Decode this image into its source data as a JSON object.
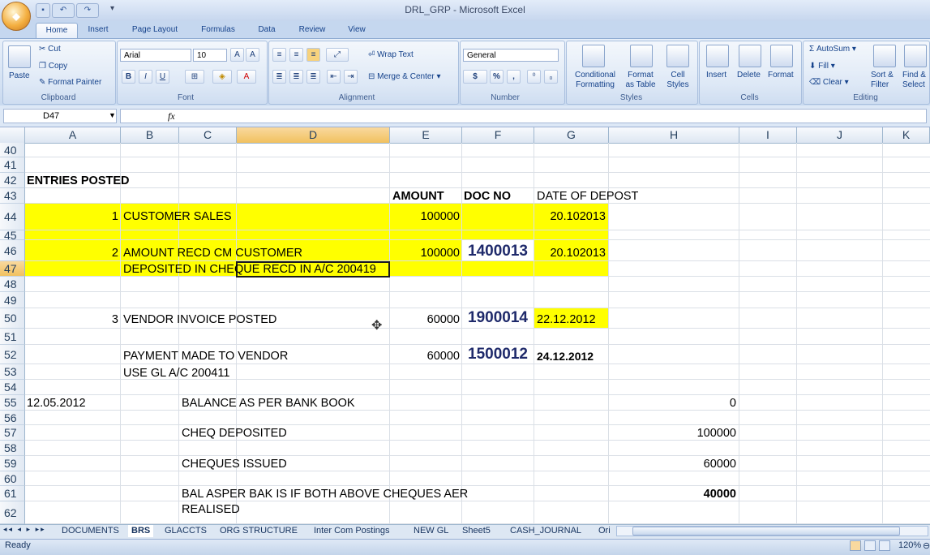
{
  "window": {
    "title": "DRL_GRP - Microsoft Excel"
  },
  "ribbon_tabs": [
    "Home",
    "Insert",
    "Page Layout",
    "Formulas",
    "Data",
    "Review",
    "View"
  ],
  "clipboard": {
    "paste": "Paste",
    "cut": "Cut",
    "copy": "Copy",
    "format_painter": "Format Painter",
    "label": "Clipboard"
  },
  "font": {
    "name": "Arial",
    "size": "10",
    "bold": "B",
    "italic": "I",
    "underline": "U",
    "label": "Font"
  },
  "alignment": {
    "wrap_text": "Wrap Text",
    "merge_center": "Merge & Center",
    "label": "Alignment"
  },
  "number": {
    "format": "General",
    "currency": "$",
    "percent": "%",
    "comma": ",",
    "label": "Number"
  },
  "styles": {
    "conditional": "Conditional",
    "formatting": "Formatting",
    "format_as": "Format",
    "as_table": "as Table",
    "cell": "Cell",
    "cell_styles": "Styles",
    "label": "Styles"
  },
  "cells": {
    "insert": "Insert",
    "delete": "Delete",
    "format": "Format",
    "label": "Cells"
  },
  "editing": {
    "autosum": "AutoSum",
    "fill": "Fill",
    "clear": "Clear",
    "sort": "Sort &",
    "filter": "Filter",
    "find": "Find &",
    "select": "Select",
    "label": "Editing"
  },
  "formula_bar": {
    "name_box": "D47",
    "fx": "fx",
    "content": ""
  },
  "columns": [
    "A",
    "B",
    "C",
    "D",
    "E",
    "F",
    "G",
    "H",
    "I",
    "J",
    "K"
  ],
  "rows": [
    "40",
    "41",
    "42",
    "43",
    "44",
    "45",
    "46",
    "47",
    "48",
    "49",
    "50",
    "51",
    "52",
    "53",
    "54",
    "55",
    "56",
    "57",
    "58",
    "59",
    "60",
    "61",
    "62"
  ],
  "cells_text": {
    "r42_a": "ENTRIES POSTED",
    "r43_e": "AMOUNT",
    "r43_f": "DOC NO",
    "r43_g": "DATE OF DEPOST",
    "r44_b": "1",
    "r44_c": "CUSTOMER SALES",
    "r44_e": "100000",
    "r44_g": "20.102013",
    "r46_b": "2",
    "r46_c": "AMOUNT RECD CM CUSTOMER",
    "r46_e": "100000",
    "r46_f": "1400013",
    "r46_g": "20.102013",
    "r47_c": "DEPOSITED IN  CHEQUE RECD IN A/C 200419",
    "r50_b": "3",
    "r50_c": "VENDOR INVOICE POSTED",
    "r50_e": "60000",
    "r50_f": "1900014",
    "r50_g": "22.12.2012",
    "r52_c": "PAYMENT MADE TO VENDOR",
    "r52_e": "60000",
    "r52_f": "1500012",
    "r52_g": "24.12.2012",
    "r53_c": "USE GL A/C 200411",
    "r55_a": "12.05.2012",
    "r55_c": "BALANCE AS PER BANK BOOK",
    "r55_h": "0",
    "r57_c": "CHEQ DEPOSITED",
    "r57_h": "100000",
    "r59_c": "CHEQUES ISSUED",
    "r59_h": "60000",
    "r61_c": "BAL ASPER BAK IS  IF BOTH ABOVE CHEQUES AER",
    "r61_h": "40000",
    "r62_c": "REALISED"
  },
  "sheet_tabs": [
    "DOCUMENTS",
    "BRS",
    "GLACCTS",
    "ORG STRUCTURE",
    "Inter Com Postings",
    "NEW GL",
    "Sheet5",
    "CASH_JOURNAL",
    "Ori"
  ],
  "active_sheet": "BRS",
  "status": {
    "mode": "Ready",
    "zoom": "120%"
  },
  "colors": {
    "highlight": "#ffff00",
    "doc_no": "#1f2a6b",
    "selection_header": "#f1c15f"
  }
}
